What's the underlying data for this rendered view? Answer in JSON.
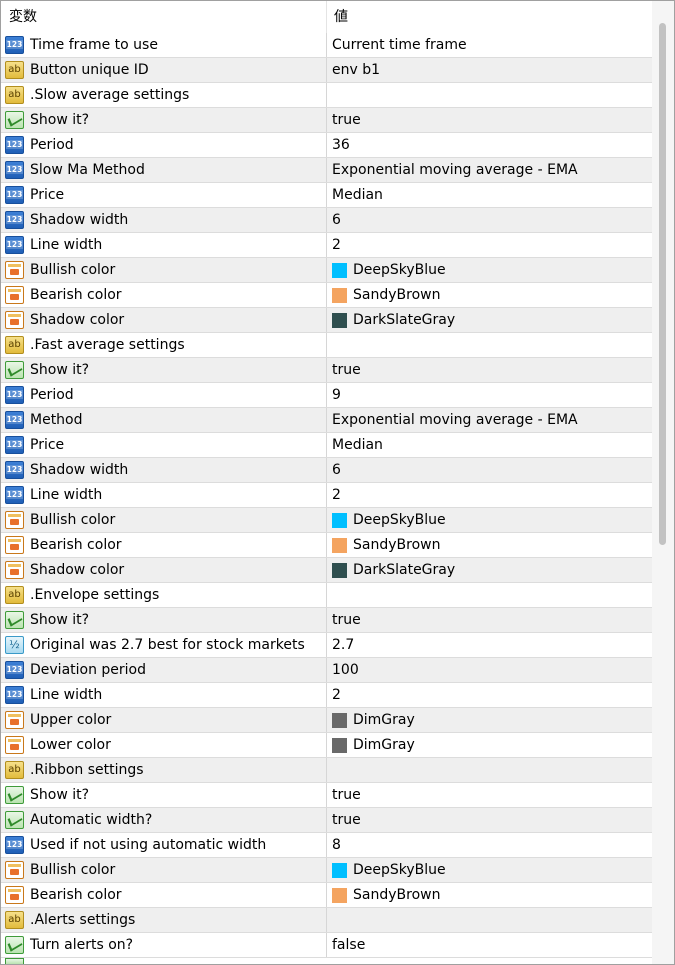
{
  "header": {
    "name": "変数",
    "value": "値"
  },
  "rows": [
    {
      "type": "int",
      "name": "Time frame to use",
      "value": "Current time frame"
    },
    {
      "type": "str",
      "name": "Button unique ID",
      "value": "env b1"
    },
    {
      "type": "str",
      "name": ".Slow average settings",
      "value": ""
    },
    {
      "type": "bool",
      "name": "Show it?",
      "value": "true"
    },
    {
      "type": "int",
      "name": "Period",
      "value": "36"
    },
    {
      "type": "int",
      "name": "Slow Ma Method",
      "value": "Exponential moving average - EMA"
    },
    {
      "type": "int",
      "name": "Price",
      "value": "Median"
    },
    {
      "type": "int",
      "name": "Shadow width",
      "value": "6"
    },
    {
      "type": "int",
      "name": "Line width",
      "value": "2"
    },
    {
      "type": "color",
      "name": "Bullish color",
      "value": "DeepSkyBlue",
      "swatch": "#00BFFF"
    },
    {
      "type": "color",
      "name": "Bearish color",
      "value": "SandyBrown",
      "swatch": "#F4A460"
    },
    {
      "type": "color",
      "name": "Shadow color",
      "value": "DarkSlateGray",
      "swatch": "#2F4F4F"
    },
    {
      "type": "str",
      "name": ".Fast average settings",
      "value": ""
    },
    {
      "type": "bool",
      "name": "Show it?",
      "value": "true"
    },
    {
      "type": "int",
      "name": "Period",
      "value": "9"
    },
    {
      "type": "int",
      "name": "Method",
      "value": "Exponential moving average - EMA"
    },
    {
      "type": "int",
      "name": "Price",
      "value": "Median"
    },
    {
      "type": "int",
      "name": "Shadow width",
      "value": "6"
    },
    {
      "type": "int",
      "name": "Line width",
      "value": "2"
    },
    {
      "type": "color",
      "name": "Bullish color",
      "value": "DeepSkyBlue",
      "swatch": "#00BFFF"
    },
    {
      "type": "color",
      "name": "Bearish color",
      "value": "SandyBrown",
      "swatch": "#F4A460"
    },
    {
      "type": "color",
      "name": "Shadow color",
      "value": "DarkSlateGray",
      "swatch": "#2F4F4F"
    },
    {
      "type": "str",
      "name": ".Envelope settings",
      "value": ""
    },
    {
      "type": "bool",
      "name": "Show it?",
      "value": "true"
    },
    {
      "type": "dbl",
      "name": "Original was 2.7 best for stock markets",
      "value": "2.7"
    },
    {
      "type": "int",
      "name": "Deviation period",
      "value": "100"
    },
    {
      "type": "int",
      "name": "Line width",
      "value": "2"
    },
    {
      "type": "color",
      "name": "Upper color",
      "value": "DimGray",
      "swatch": "#696969"
    },
    {
      "type": "color",
      "name": "Lower color",
      "value": "DimGray",
      "swatch": "#696969"
    },
    {
      "type": "str",
      "name": ".Ribbon settings",
      "value": ""
    },
    {
      "type": "bool",
      "name": "Show it?",
      "value": "true"
    },
    {
      "type": "bool",
      "name": "Automatic width?",
      "value": "true"
    },
    {
      "type": "int",
      "name": "Used if not using automatic width",
      "value": "8"
    },
    {
      "type": "color",
      "name": "Bullish color",
      "value": "DeepSkyBlue",
      "swatch": "#00BFFF"
    },
    {
      "type": "color",
      "name": "Bearish color",
      "value": "SandyBrown",
      "swatch": "#F4A460"
    },
    {
      "type": "str",
      "name": ".Alerts settings",
      "value": ""
    },
    {
      "type": "bool",
      "name": "Turn alerts on?",
      "value": "false"
    }
  ]
}
